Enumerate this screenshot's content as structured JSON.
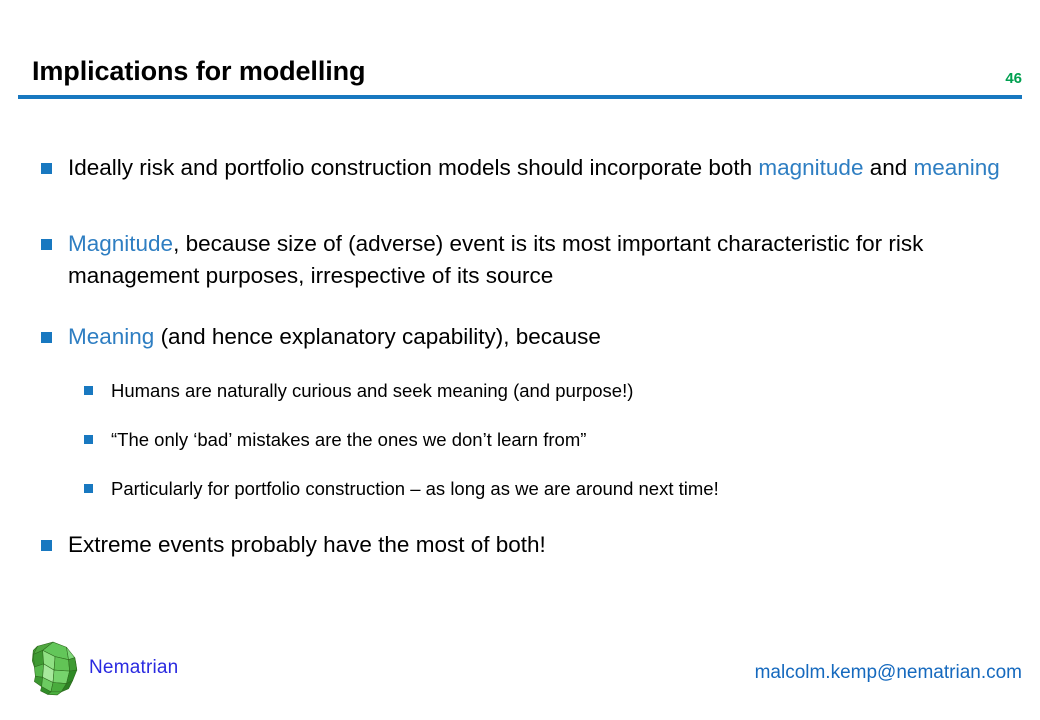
{
  "slide": {
    "title": "Implications for modelling",
    "page_number": "46",
    "accent_blue": "#1878C0",
    "highlight_blue": "#2E7EC2",
    "page_number_green": "#00A050",
    "brand_blue": "#2A2AE0",
    "email_blue": "#1569BE"
  },
  "bullets": {
    "b1": {
      "line1": "Ideally risk and portfolio construction models should incorporate both ",
      "kw1": "magnitude",
      "mid": " and ",
      "kw2": "meaning"
    },
    "b2": {
      "kw": "Magnitude",
      "rest": ", because size of (adverse) event is its most important characteristic for risk management purposes, irrespective of its source"
    },
    "b3": {
      "kw": "Meaning",
      "rest": " (and hence explanatory capability), because"
    },
    "sub": [
      "Humans are naturally curious and seek meaning (and purpose!)",
      "“The only ‘bad’ mistakes are the ones we don’t learn from”",
      "Particularly for portfolio construction – as long as we are around next time!"
    ],
    "b4": "Extreme events probably have the most of both!"
  },
  "footer": {
    "brand": "Nematrian",
    "email": "malcolm.kemp@nematrian.com",
    "logo_icon": "green-polyhedron-icon"
  }
}
